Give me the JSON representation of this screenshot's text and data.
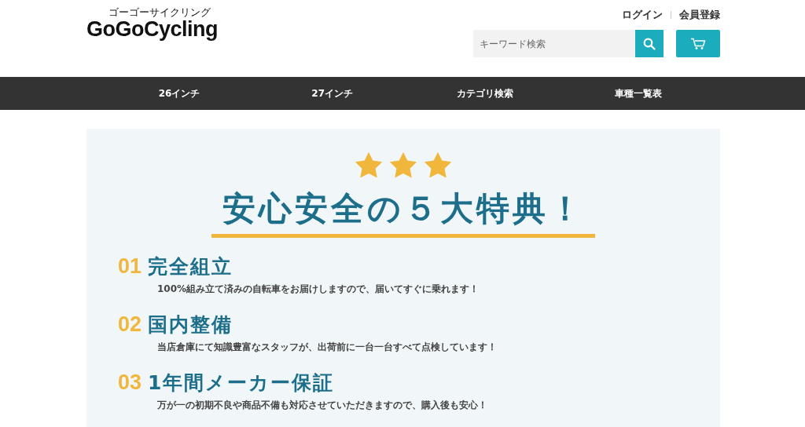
{
  "header": {
    "logo_kana": "ゴーゴーサイクリング",
    "logo": "GoGoCycling",
    "links": [
      "ログイン",
      "会員登録"
    ],
    "search": {
      "placeholder": "キーワード検索"
    }
  },
  "nav": [
    "26インチ",
    "27インチ",
    "カテゴリ検索",
    "車種一覧表"
  ],
  "benefits": {
    "stars": 3,
    "title": "安心安全の５大特典！",
    "items": [
      {
        "number": "01",
        "heading": "完全組立",
        "text": "100%組み立て済みの自転車をお届けしますので、届いてすぐに乗れます！"
      },
      {
        "number": "02",
        "heading": "国内整備",
        "text": "当店倉庫にて知識豊富なスタッフが、出荷前に一台一台すべて点検しています！"
      },
      {
        "number": "03",
        "heading": "1年間メーカー保証",
        "text": "万が一の初期不良や商品不備も対応させていただきますので、購入後も安心！"
      }
    ]
  }
}
